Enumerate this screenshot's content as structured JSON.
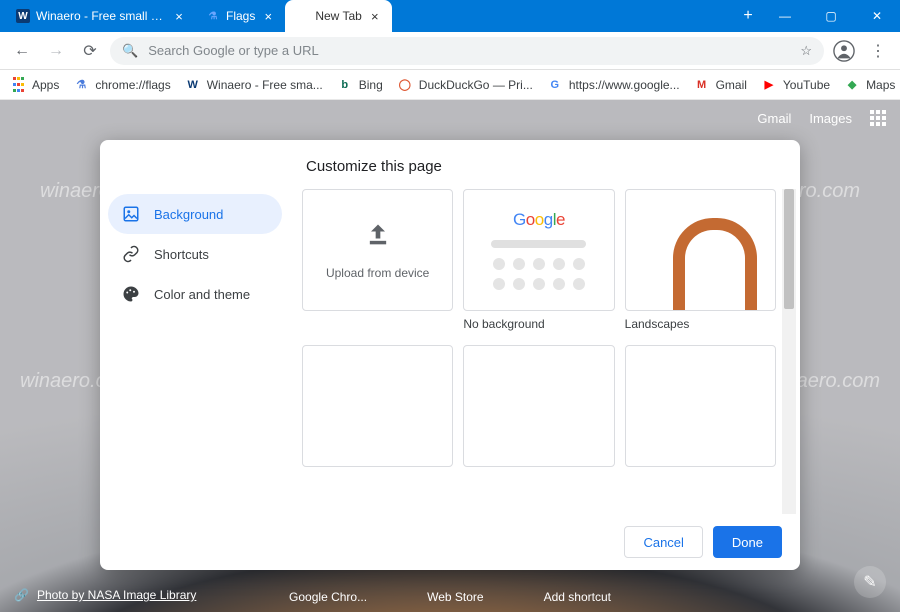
{
  "window": {
    "tabs": [
      {
        "label": "Winaero - Free small and useful s",
        "favicon_letter": "W",
        "favicon_bg": "#0b3a73",
        "favicon_fg": "#fff"
      },
      {
        "label": "Flags",
        "favicon_letter": "⚗",
        "favicon_bg": "transparent",
        "favicon_fg": "#6aa6ff"
      },
      {
        "label": "New Tab",
        "favicon_letter": "",
        "favicon_bg": "transparent",
        "favicon_fg": "#9aa0a6"
      }
    ],
    "active_tab_index": 2,
    "newtab_plus": "+",
    "controls": {
      "min": "—",
      "max": "▢",
      "close": "✕"
    }
  },
  "toolbar": {
    "back": "←",
    "forward": "→",
    "reload": "⟳",
    "omnibox_placeholder": "Search Google or type a URL",
    "star": "☆",
    "profile": "👤",
    "menu": "⋮"
  },
  "bookmarks": {
    "apps_label": "Apps",
    "items": [
      {
        "label": "chrome://flags",
        "icon": "⚗",
        "color": "#4a7bdc"
      },
      {
        "label": "Winaero - Free sma...",
        "icon": "W",
        "color": "#0b3a73"
      },
      {
        "label": "Bing",
        "icon": "b",
        "color": "#0b6b53"
      },
      {
        "label": "DuckDuckGo — Pri...",
        "icon": "◯",
        "color": "#de5833"
      },
      {
        "label": "https://www.google...",
        "icon": "G",
        "color": "#4285f4"
      },
      {
        "label": "Gmail",
        "icon": "M",
        "color": "#d93025"
      },
      {
        "label": "YouTube",
        "icon": "▶",
        "color": "#ff0000"
      },
      {
        "label": "Maps",
        "icon": "◆",
        "color": "#34a853"
      }
    ]
  },
  "ntp": {
    "topright": {
      "gmail": "Gmail",
      "images": "Images"
    },
    "attribution": {
      "link_icon": "🔗",
      "text": "Photo by NASA Image Library"
    },
    "shortcuts_bottom": [
      "Google Chro...",
      "Web Store",
      "Add shortcut"
    ],
    "edit_icon": "✎"
  },
  "dialog": {
    "title": "Customize this page",
    "sidebar": [
      {
        "label": "Background",
        "icon": "image-icon",
        "active": true
      },
      {
        "label": "Shortcuts",
        "icon": "link-icon",
        "active": false
      },
      {
        "label": "Color and theme",
        "icon": "palette-icon",
        "active": false
      }
    ],
    "tiles": [
      {
        "kind": "upload",
        "caption": "",
        "upload_text": "Upload from device"
      },
      {
        "kind": "nobg",
        "caption": "No background"
      },
      {
        "kind": "image",
        "caption": "Landscapes",
        "bg_class": "bg-landscape"
      },
      {
        "kind": "image",
        "caption": "",
        "bg_class": "bg-texture1"
      },
      {
        "kind": "image",
        "caption": "",
        "bg_class": "bg-texture2"
      },
      {
        "kind": "image",
        "caption": "",
        "bg_class": "bg-texture3"
      }
    ],
    "google_letters": [
      {
        "c": "G",
        "color": "#4285f4"
      },
      {
        "c": "o",
        "color": "#ea4335"
      },
      {
        "c": "o",
        "color": "#fbbc05"
      },
      {
        "c": "g",
        "color": "#4285f4"
      },
      {
        "c": "l",
        "color": "#34a853"
      },
      {
        "c": "e",
        "color": "#ea4335"
      }
    ],
    "buttons": {
      "cancel": "Cancel",
      "done": "Done"
    }
  },
  "watermarks": [
    "winaero.com",
    "winaero.com",
    "winaero.com",
    "winaero.com",
    "winaero.com",
    "winaero.com"
  ]
}
